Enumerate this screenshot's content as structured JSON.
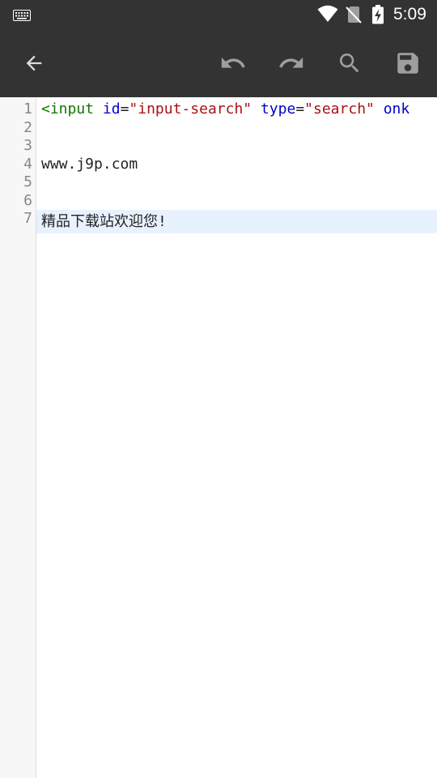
{
  "status_bar": {
    "time": "5:09",
    "icons": [
      "keyboard-icon",
      "wifi-icon",
      "no-sim-icon",
      "battery-charging-icon"
    ]
  },
  "toolbar": {
    "buttons": [
      "back-arrow-icon",
      "undo-icon",
      "redo-icon",
      "search-icon",
      "save-icon"
    ]
  },
  "editor": {
    "line_numbers": [
      "1",
      "2",
      "3",
      "4",
      "5",
      "6",
      "7"
    ],
    "line1": {
      "tag_open": "<input",
      "attr1": "id",
      "eq1": "=",
      "val1": "\"input-search\"",
      "attr2": "type",
      "eq2": "=",
      "val2": "\"search\"",
      "attr3": "onk"
    },
    "line4": "www.j9p.com",
    "line7": "精品下载站欢迎您!",
    "colors": {
      "tag": "#117700",
      "attribute": "#0000cc",
      "string": "#aa1111",
      "active_line": "#e8f2ff",
      "bar": "#333333"
    }
  }
}
